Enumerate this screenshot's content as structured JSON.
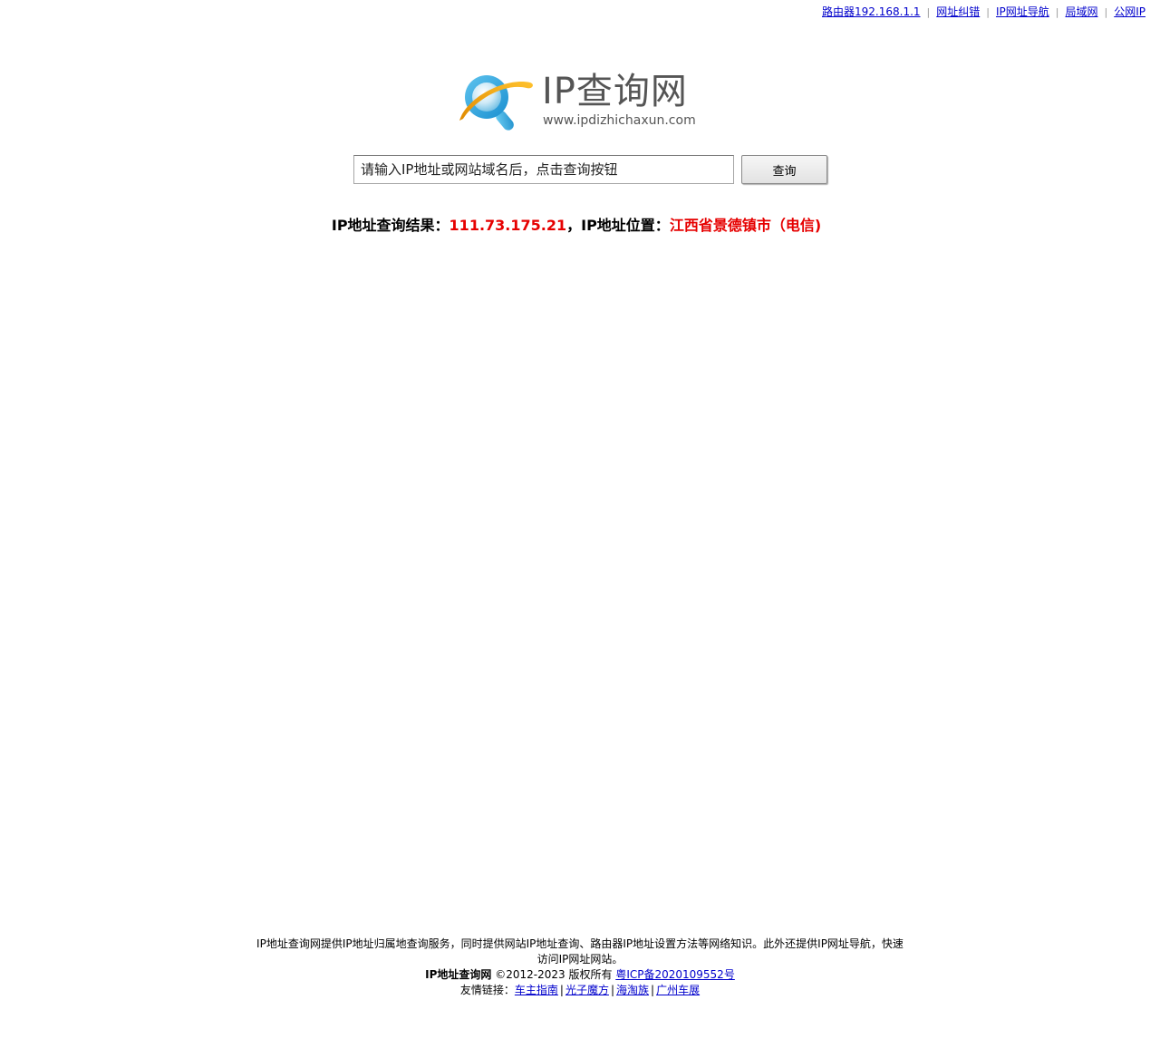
{
  "topnav": {
    "links": [
      "路由器192.168.1.1",
      "网址纠错",
      "IP网址导航",
      "局域网",
      "公网IP"
    ],
    "separator": "|"
  },
  "logo": {
    "title": "IP查询网",
    "url": "www.ipdizhichaxun.com",
    "icon": "magnifier-globe-icon"
  },
  "search": {
    "placeholder": "请输入IP地址或网站域名后，点击查询按钮",
    "button_label": "查询"
  },
  "result": {
    "label_ip": "IP地址查询结果：",
    "ip": "111.73.175.21",
    "comma": "，",
    "label_location": "IP地址位置：",
    "location": "江西省景德镇市（电信)",
    "accent_color": "#e60000"
  },
  "footer": {
    "description": "IP地址查询网提供IP地址归属地查询服务，同时提供网站IP地址查询、路由器IP地址设置方法等网络知识。此外还提供IP网址导航，快速访问IP网址网站。",
    "site_name": "IP地址查询网",
    "copyright": "©2012-2023  版权所有",
    "icp": "粤ICP备2020109552号",
    "friend_links_label": "友情链接：",
    "friend_links": [
      "车主指南",
      "光子魔方",
      "海淘族",
      "广州车展"
    ],
    "friend_sep": "|"
  }
}
